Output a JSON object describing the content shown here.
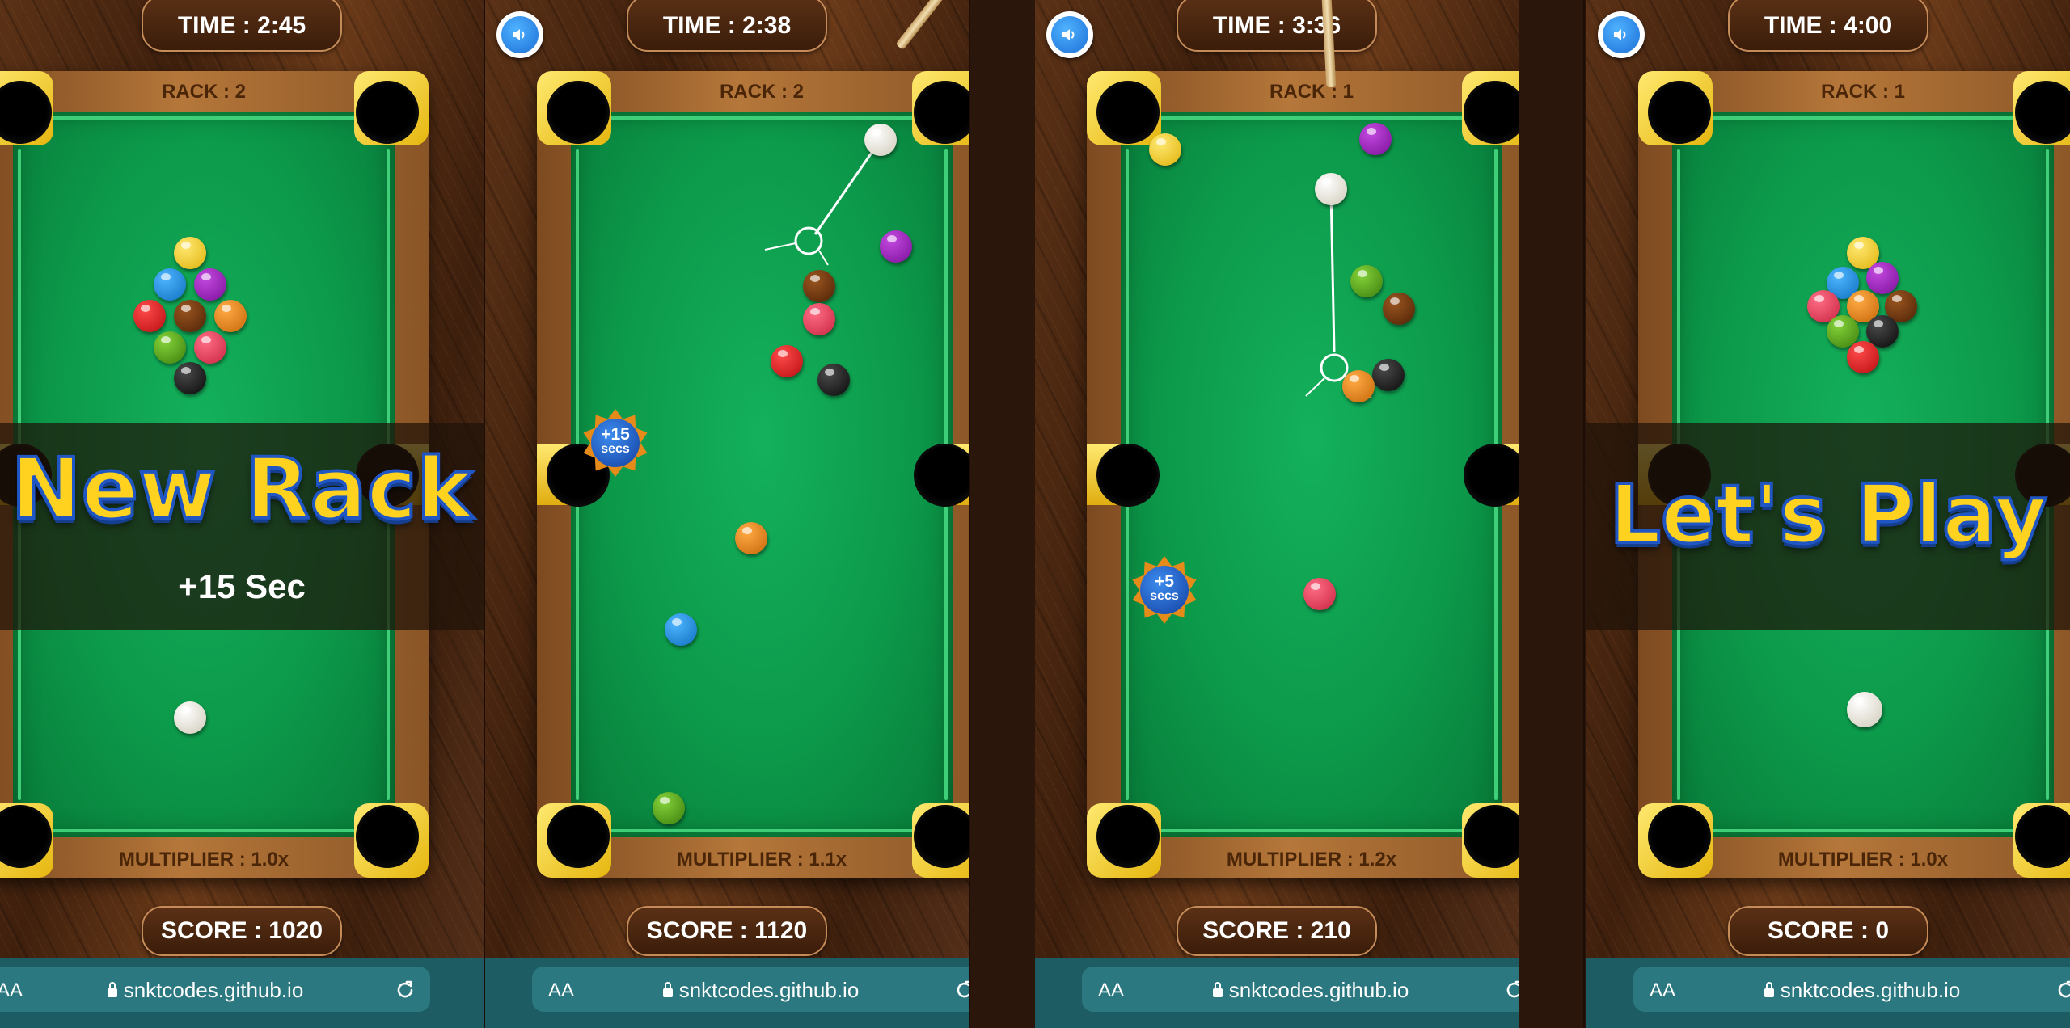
{
  "panels": [
    {
      "time_label": "TIME : 2:45",
      "rack_label": "RACK : 2",
      "multiplier_label": "MULTIPLIER : 1.0x",
      "score_label": "SCORE : 1020",
      "banner_title": "New Rack",
      "banner_subtitle": "+15 Sec",
      "url": "snktcodes.github.io",
      "text_size_button": "AA"
    },
    {
      "time_label": "TIME : 2:38",
      "rack_label": "RACK : 2",
      "multiplier_label": "MULTIPLIER : 1.1x",
      "score_label": "SCORE : 1120",
      "bonus_value": "+15",
      "bonus_unit": "secs",
      "url": "snktcodes.github.io",
      "text_size_button": "AA"
    },
    {
      "time_label": "TIME : 3:36",
      "rack_label": "RACK : 1",
      "multiplier_label": "MULTIPLIER : 1.2x",
      "score_label": "SCORE : 210",
      "bonus_value": "+5",
      "bonus_unit": "secs",
      "url": "snktcodes.github.io",
      "text_size_button": "AA"
    },
    {
      "time_label": "TIME : 4:00",
      "rack_label": "RACK : 1",
      "multiplier_label": "MULTIPLIER : 1.0x",
      "score_label": "SCORE : 0",
      "banner_title": "Let's Play",
      "url": "snktcodes.github.io",
      "text_size_button": "AA"
    }
  ],
  "icons": {
    "sound": "speaker-icon",
    "reload": "reload-icon",
    "lock": "lock-icon"
  },
  "colors": {
    "felt": "#0c994a",
    "rail_wood": "#b5773a",
    "pocket_plate": "#ffd93a",
    "banner_text": "#ffd21f",
    "banner_outline": "#1f56c4",
    "browser_bar": "#1e5c63"
  },
  "ball_colors": {
    "yellow": "#f2c81c",
    "blue": "#1a8ad8",
    "purple": "#9a1fb5",
    "red": "#d8161c",
    "brown": "#6b3208",
    "orange": "#e17c14",
    "green": "#4c9a12",
    "pink": "#e03a55",
    "black": "#151515",
    "white": "#f2efe6"
  }
}
